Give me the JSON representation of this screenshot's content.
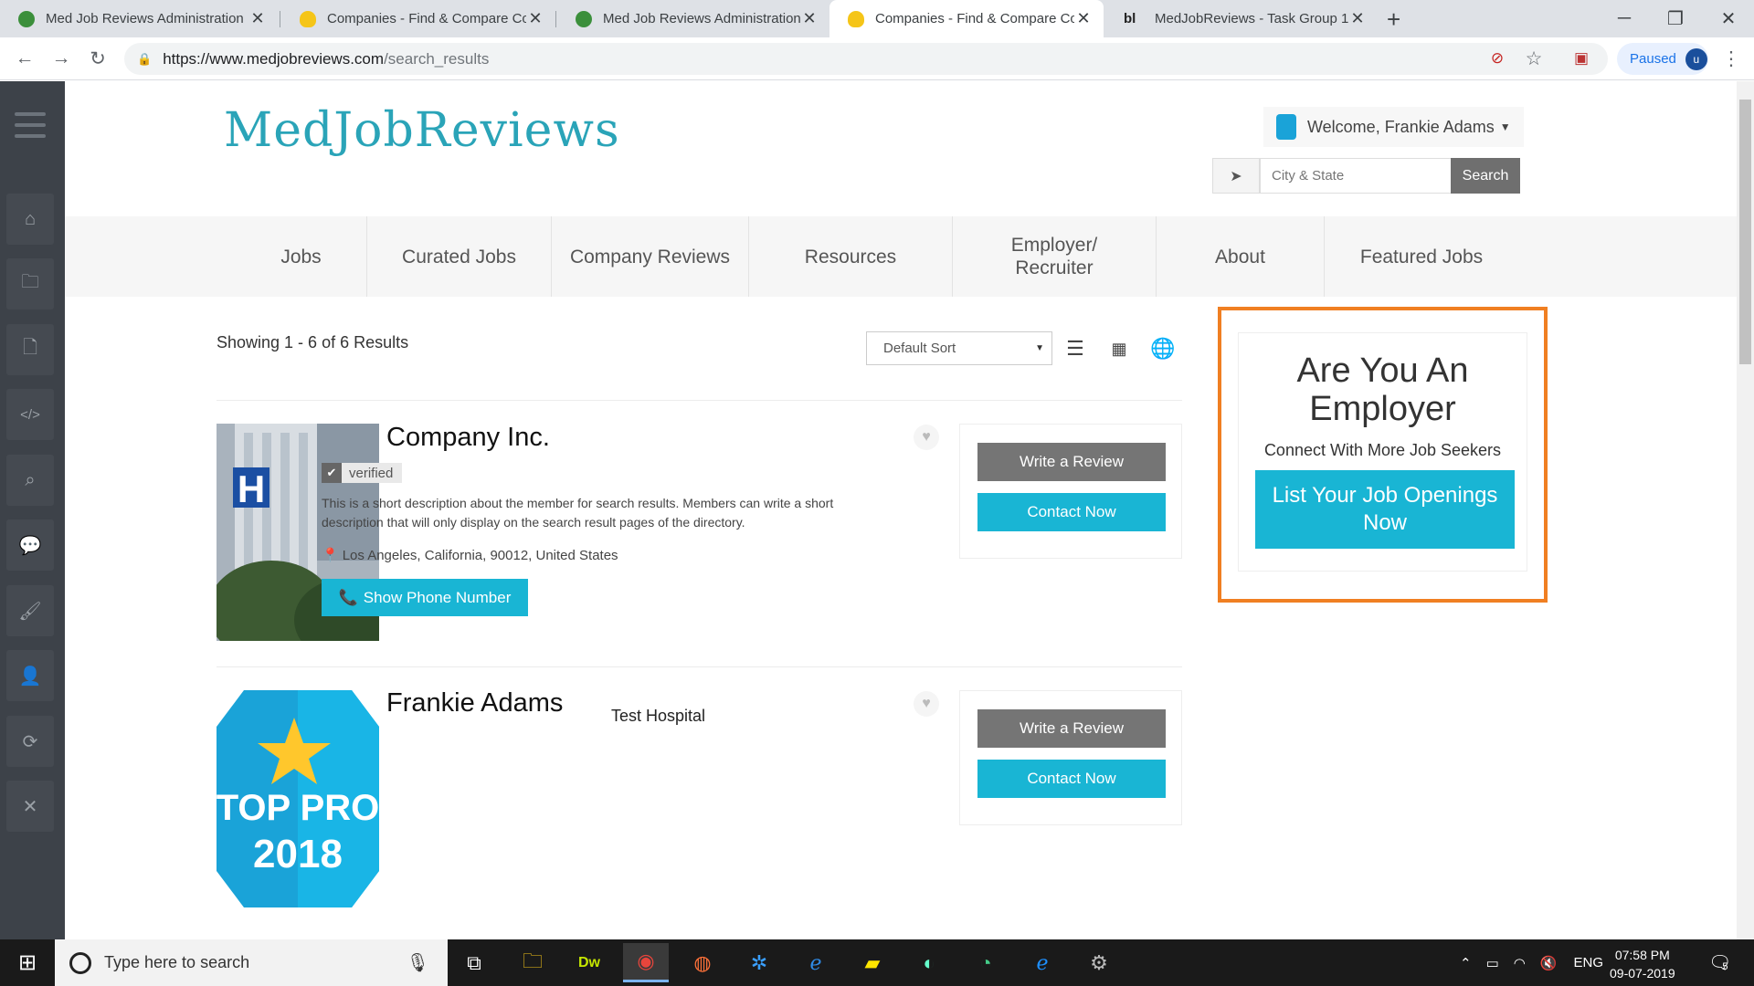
{
  "browser": {
    "tabs": [
      {
        "title": "Med Job Reviews Administration",
        "active": false
      },
      {
        "title": "Companies - Find & Compare Co",
        "active": false
      },
      {
        "title": "Med Job Reviews Administration",
        "active": false
      },
      {
        "title": "Companies - Find & Compare Co",
        "active": true
      },
      {
        "title": "MedJobReviews - Task Group 1",
        "active": false
      }
    ],
    "url_host": "https://www.medjobreviews.com",
    "url_path": "/search_results",
    "profile_status": "Paused",
    "profile_initial": "u"
  },
  "site": {
    "logo": "MedJobReviews",
    "welcome": "Welcome, Frankie Adams",
    "city_placeholder": "City & State",
    "search_label": "Search",
    "nav": [
      {
        "label": "Jobs"
      },
      {
        "label": "Curated Jobs"
      },
      {
        "label": "Company Reviews"
      },
      {
        "label": "Resources"
      },
      {
        "label": "Employer/ Recruiter"
      },
      {
        "label": "About"
      },
      {
        "label": "Featured Jobs"
      }
    ]
  },
  "results": {
    "showing": "Showing 1 - 6 of 6 Results",
    "sort": "Default Sort",
    "items": [
      {
        "name": "Company Inc.",
        "verified": "verified",
        "description": "This is a short description about the member for search results. Members can write a short description that will only display on the search result pages of the directory.",
        "address": "Los Angeles, California, 90012, United States",
        "phone_label": "Show Phone Number",
        "review_label": "Write a Review",
        "contact_label": "Contact Now"
      },
      {
        "name": "Frankie Adams",
        "subtitle": "Test Hospital",
        "badge_top": "TOP PRO",
        "badge_year": "2018",
        "review_label": "Write a Review",
        "contact_label": "Contact Now"
      }
    ]
  },
  "promo": {
    "title": "Are You An Employer",
    "subtitle": "Connect With More Job Seekers",
    "cta": "List Your Job Openings Now"
  },
  "taskbar": {
    "search_placeholder": "Type here to search",
    "lang": "ENG",
    "time": "07:58 PM",
    "date": "09-07-2019",
    "notification_count": "5"
  },
  "colors": {
    "accent": "#19b5d4",
    "promo_border": "#f07f22",
    "logo": "#2aa4b8"
  }
}
